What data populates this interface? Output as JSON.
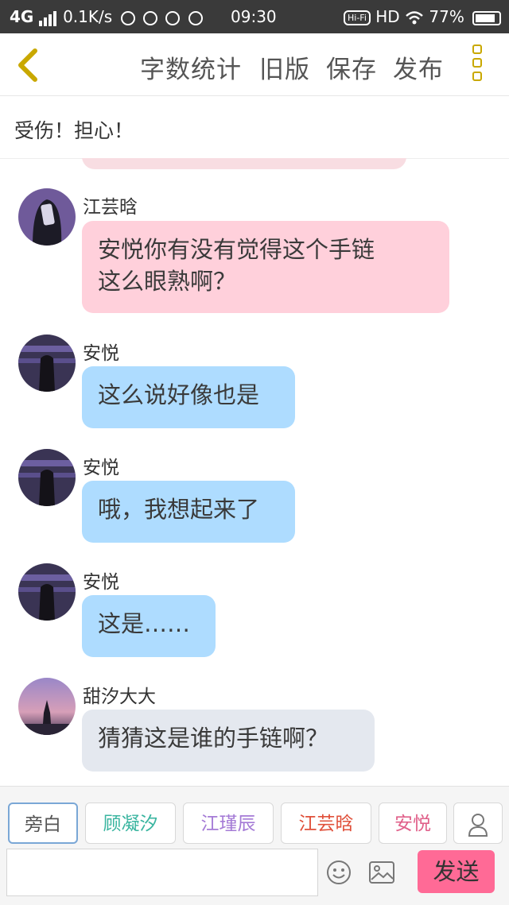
{
  "status_bar": {
    "network": "4G",
    "speed": "0.1K/s",
    "time": "09:30",
    "hifi": "Hi-Fi",
    "hd": "HD",
    "battery": "77%"
  },
  "header": {
    "buttons": [
      "字数统计",
      "旧版",
      "保存",
      "发布"
    ]
  },
  "title": "受伤！担心！",
  "messages": [
    {
      "name": "江芸晗",
      "lines": [
        "安悦你有没有觉得这个手链",
        "这么眼熟啊？"
      ],
      "bubble_color": "#ffd0db",
      "avatar": "girl-avatar-dark"
    },
    {
      "name": "安悦",
      "lines": [
        "这么说好像也是"
      ],
      "bubble_color": "#aedcff",
      "avatar": "purple-night-avatar"
    },
    {
      "name": "安悦",
      "lines": [
        "哦，我想起来了"
      ],
      "bubble_color": "#aedcff",
      "avatar": "purple-night-avatar"
    },
    {
      "name": "安悦",
      "lines": [
        "这是……"
      ],
      "bubble_color": "#aedcff",
      "avatar": "purple-night-avatar"
    },
    {
      "name": "甜汐大大",
      "lines": [
        "猜猜这是谁的手链啊？"
      ],
      "bubble_color": "#e4e8ef",
      "avatar": "sunset-avatar"
    }
  ],
  "roles": [
    {
      "label": "旁白",
      "color": "#555555"
    },
    {
      "label": "顾凝汐",
      "color": "#3ab5a0"
    },
    {
      "label": "江瑾辰",
      "color": "#a57bd6"
    },
    {
      "label": "江芸晗",
      "color": "#e0503a"
    },
    {
      "label": "安悦",
      "color": "#e0608a"
    }
  ],
  "input": {
    "value": "",
    "placeholder": ""
  },
  "send_label": "发送",
  "icons": {
    "back": "chevron-left-icon",
    "more": "more-vertical-icon",
    "role_add": "user-icon",
    "emoji": "smiley-icon",
    "image": "image-icon"
  },
  "colors": {
    "accent_yellow": "#c9a800",
    "send_button": "#ff6a96"
  }
}
